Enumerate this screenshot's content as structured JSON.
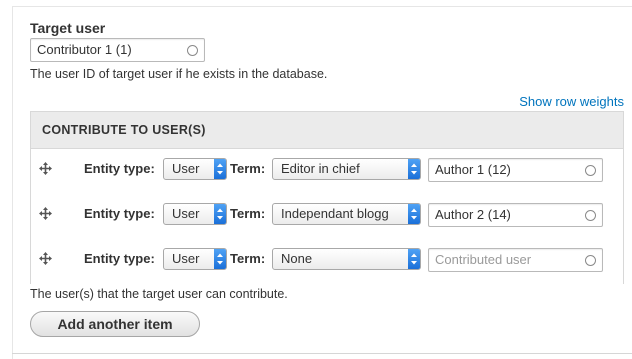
{
  "target_user": {
    "label": "Target user",
    "value": "Contributor 1 (1)",
    "description": "The user ID of target user if he exists in the database."
  },
  "show_row_weights": "Show row weights",
  "table": {
    "header": "CONTRIBUTE TO USER(S)",
    "entity_type_label": "Entity type:",
    "term_label": "Term:",
    "rows": [
      {
        "entity_type": "User",
        "term": "Editor in chief",
        "user_value": "Author 1 (12)",
        "user_placeholder": ""
      },
      {
        "entity_type": "User",
        "term": "Independant blogg",
        "user_value": "Author 2 (14)",
        "user_placeholder": ""
      },
      {
        "entity_type": "User",
        "term": "None",
        "user_value": "",
        "user_placeholder": "Contributed user"
      }
    ]
  },
  "help_text": "The user(s) that the target user can contribute.",
  "add_button": "Add another item",
  "colors": {
    "link": "#0074bd",
    "select_arrow": "#2a7de1"
  },
  "icons": {
    "drag": "drag-handle-icon",
    "throbber": "autocomplete-throbber-icon",
    "select": "select-arrows-icon"
  }
}
